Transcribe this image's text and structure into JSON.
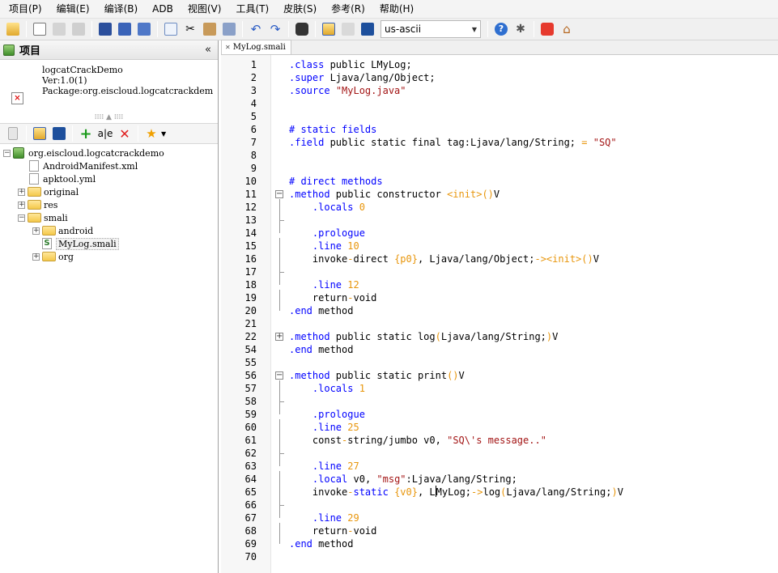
{
  "menu": [
    "项目(P)",
    "编辑(E)",
    "编译(B)",
    "ADB",
    "视图(V)",
    "工具(T)",
    "皮肤(S)",
    "参考(R)",
    "帮助(H)"
  ],
  "toolbar": {
    "encoding": "us-ascii"
  },
  "project_panel": {
    "title": "项目",
    "collapse": "«",
    "info": [
      "logcatCrackDemo",
      "Ver:1.0(1)",
      "Package:org.eiscloud.logcatcrackdem"
    ],
    "tree": {
      "root": "org.eiscloud.logcatcrackdemo",
      "manifest": "AndroidManifest.xml",
      "apktool": "apktool.yml",
      "original": "original",
      "res": "res",
      "smali": "smali",
      "android": "android",
      "mylog": "MyLog.smali",
      "org": "org"
    }
  },
  "editor": {
    "tab_label": "MyLog.smali",
    "line_numbers": [
      "1",
      "2",
      "3",
      "4",
      "5",
      "6",
      "7",
      "8",
      "9",
      "10",
      "11",
      "12",
      "13",
      "14",
      "15",
      "16",
      "17",
      "18",
      "19",
      "20",
      "21",
      "22",
      "54",
      "55",
      "56",
      "57",
      "58",
      "59",
      "60",
      "61",
      "62",
      "63",
      "64",
      "65",
      "66",
      "67",
      "68",
      "69",
      "70"
    ],
    "lines": [
      ".class public LMyLog;",
      ".super Ljava/lang/Object;",
      ".source \"MyLog.java\"",
      "",
      "",
      "# static fields",
      ".field public static final tag:Ljava/lang/String; = \"SQ\"",
      "",
      "",
      "# direct methods",
      ".method public constructor <init>()V",
      "    .locals 0",
      "",
      "    .prologue",
      "    .line 10",
      "    invoke-direct {p0}, Ljava/lang/Object;-><init>()V",
      "",
      "    .line 12",
      "    return-void",
      ".end method",
      "",
      ".method public static log(Ljava/lang/String;)V",
      ".end method",
      "",
      ".method public static print()V",
      "    .locals 1",
      "",
      "    .prologue",
      "    .line 25",
      "    const-string/jumbo v0, \"SQ\\'s message..\"",
      "",
      "    .line 27",
      "    .local v0, \"msg\":Ljava/lang/String;",
      "    invoke-static {v0}, LMyLog;->log(Ljava/lang/String;)V",
      "",
      "    .line 29",
      "    return-void",
      ".end method",
      ""
    ]
  }
}
